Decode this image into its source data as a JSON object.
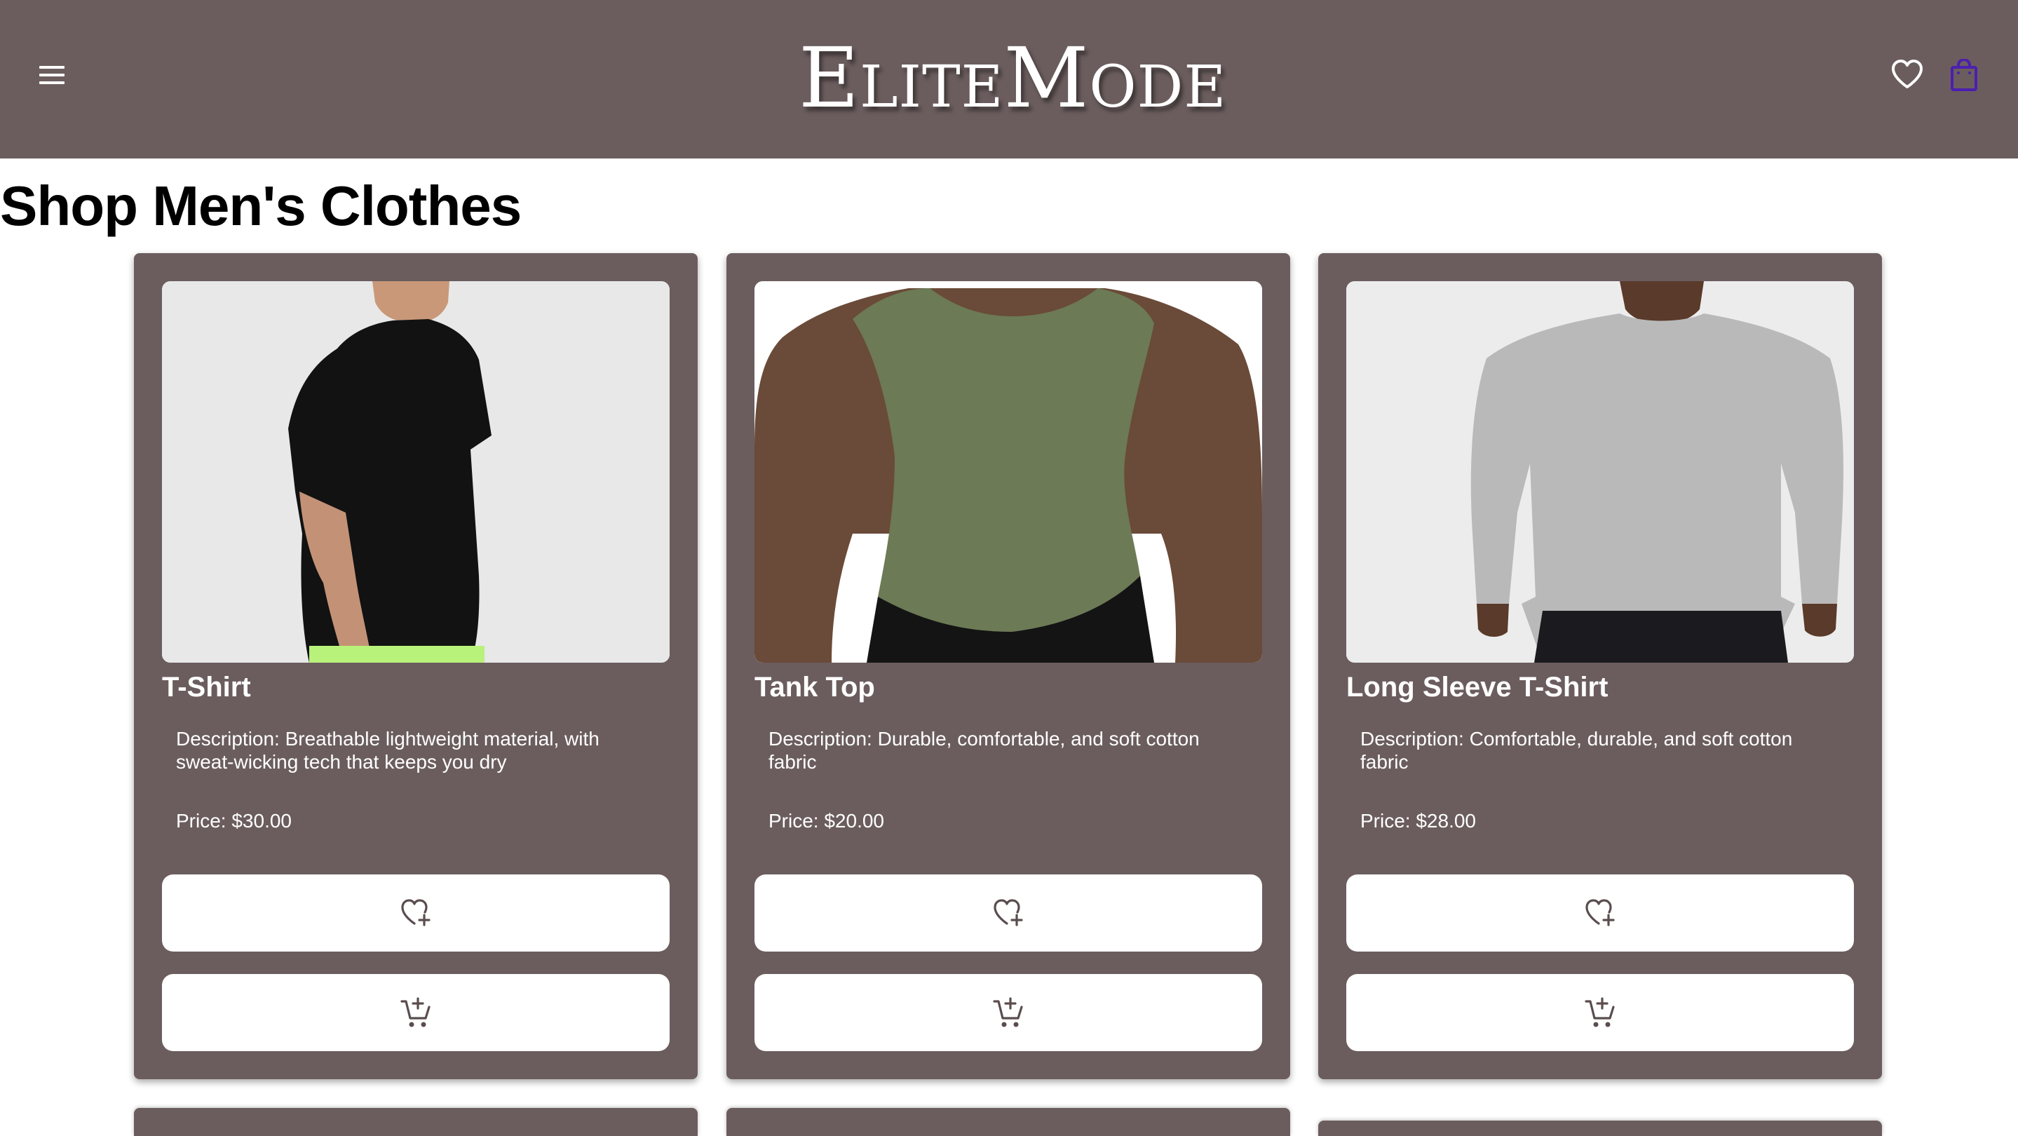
{
  "header": {
    "brand_cap_e": "E",
    "brand_lite": "LITE",
    "brand_cap_m": "M",
    "brand_ode": "ODE",
    "menu_icon": "hamburger-menu-icon",
    "favorites_icon": "heart-icon",
    "bag_icon": "shopping-bag-icon"
  },
  "page": {
    "title": "Shop Men's Clothes"
  },
  "products": [
    {
      "name": "T-Shirt",
      "description": "Description: Breathable lightweight material, with sweat-wicking tech that keeps you dry",
      "price": "Price: $30.00",
      "image": "black t-shirt photo"
    },
    {
      "name": "Tank Top",
      "description": "Description: Durable, comfortable, and soft cotton fabric",
      "price": "Price: $20.00",
      "image": "green tank top photo"
    },
    {
      "name": "Long Sleeve T-Shirt",
      "description": "Description: Comfortable, durable, and soft cotton fabric",
      "price": "Price: $28.00",
      "image": "grey long sleeve t-shirt photo"
    }
  ],
  "card_actions": {
    "wishlist_icon": "heart-plus-icon",
    "cart_icon": "add-to-cart-icon"
  },
  "colors": {
    "header_bg": "#6b5d5e",
    "card_bg": "#6b5d5e",
    "bag_icon": "#4b1fb0",
    "text_light": "#ffffff"
  }
}
